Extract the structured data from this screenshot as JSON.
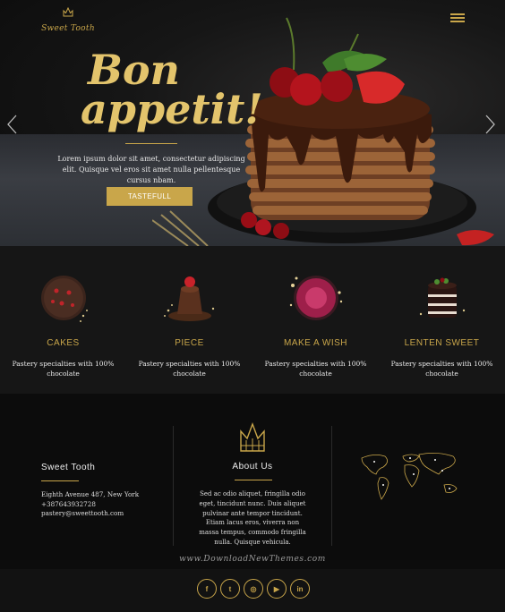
{
  "brand": {
    "logo_text": "Sweet Tooth",
    "accent": "#c9a64a"
  },
  "hero": {
    "headline_1": "Bon",
    "headline_2": "appetit!",
    "text": "Lorem ipsum dolor sit amet, consectetur adipiscing elit. Quisque vel eros sit amet nulla pellentesque cursus nbam.",
    "cta_label": "TASTEFULL",
    "prev_icon": "chevron-left-icon",
    "next_icon": "chevron-right-icon",
    "menu_icon": "hamburger-icon"
  },
  "features": [
    {
      "title": "CAKES",
      "desc": "Pastery specialties with 100% chocolate"
    },
    {
      "title": "PIECE",
      "desc": "Pastery specialties with 100% chocolate"
    },
    {
      "title": "MAKE A WISH",
      "desc": "Pastery specialties with 100% chocolate"
    },
    {
      "title": "LENTEN SWEET",
      "desc": "Pastery specialties with 100% chocolate"
    }
  ],
  "contact": {
    "title": "Sweet Tooth",
    "address": "Eighth Avenue 487, New York",
    "phone": "+387643932728",
    "email": "pastery@sweettooth.com"
  },
  "about": {
    "title": "About Us",
    "text": "Sed ac odio aliquet, fringilla odio eget, tincidunt nunc. Duis aliquet pulvinar ante tempor tincidunt. Etiam lacus eros, viverra non massa tempus, commodo fringilla nulla. Quisque vehicula."
  },
  "watermark": "www.DownloadNewThemes.com",
  "social": [
    {
      "label": "f",
      "icon": "facebook-icon"
    },
    {
      "label": "t",
      "icon": "twitter-icon"
    },
    {
      "label": "◎",
      "icon": "instagram-icon"
    },
    {
      "label": "▶",
      "icon": "youtube-icon"
    },
    {
      "label": "in",
      "icon": "linkedin-icon"
    }
  ]
}
